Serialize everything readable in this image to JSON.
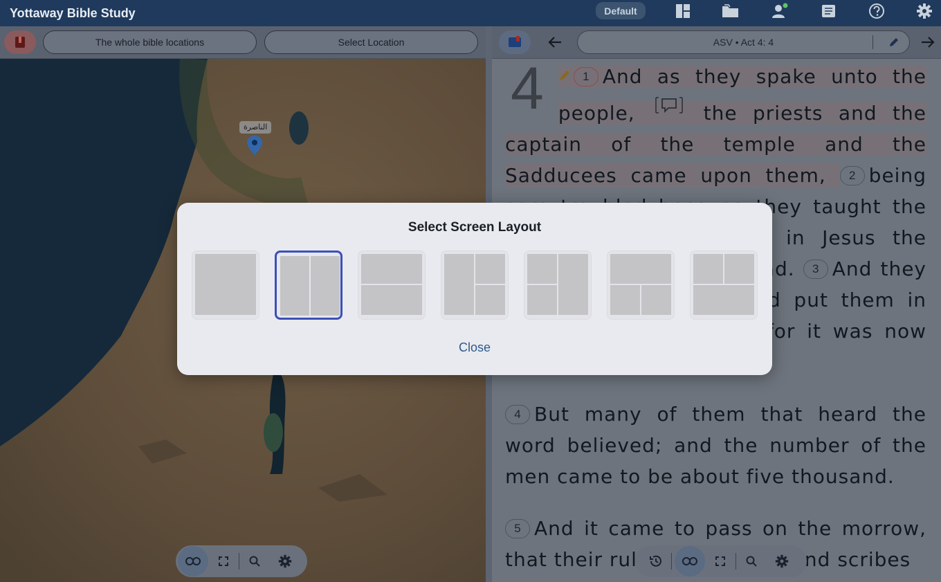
{
  "app": {
    "title": "Yottaway Bible Study",
    "profile_label": "Default",
    "icons": [
      "layout-icon",
      "folder-icon",
      "user-add-icon",
      "book-icon",
      "help-icon",
      "gear-icon"
    ]
  },
  "map_panel": {
    "location_filter": "The whole bible locations",
    "location_select": "Select Location",
    "marker_label": "الناصرة"
  },
  "bible_panel": {
    "reference": "ASV • Act 4: 4",
    "chapter": "4",
    "verses": [
      {
        "num": "1",
        "text": "And as they spake unto the people,"
      },
      {
        "num": "",
        "text": "the priests and the captain of the temple and the Sadducees came upon them,"
      },
      {
        "num": "2",
        "text": "being sore troubled because they taught the people, and proclaimed in Jesus the resurrection from the dead."
      },
      {
        "num": "3",
        "text": "And they laid hands on them, and put them in ward unto the morrow: for it was now eventide."
      },
      {
        "num": "4",
        "text": "But many of them that heard the word believed; and the number of the men came to be about five thousand."
      },
      {
        "num": "5",
        "text": "And it came to pass on the morrow, that their rulers and elders and scribes"
      }
    ]
  },
  "modal": {
    "title": "Select Screen Layout",
    "close_label": "Close",
    "options": [
      "single",
      "two-columns",
      "two-rows",
      "left-big-right-split",
      "left-split-right-big",
      "top-big-bottom-split",
      "top-split-bottom-big"
    ],
    "selected": "two-columns"
  },
  "colors": {
    "topbar": "#1f3a5c",
    "selected_border": "#3b4fb8",
    "close_link": "#2d5a8c",
    "marker": "#1e6fd9"
  }
}
